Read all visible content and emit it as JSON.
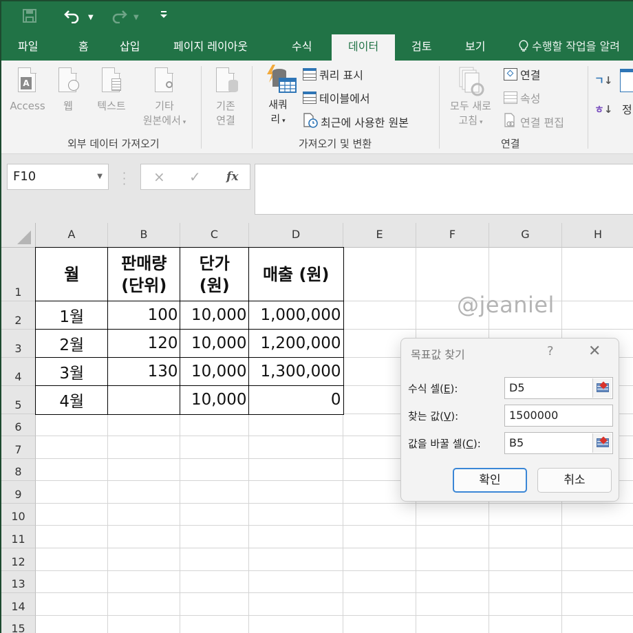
{
  "qat": {
    "save_icon": "save-icon",
    "undo_icon": "undo-icon",
    "redo_icon": "redo-icon",
    "customize_icon": "customize-qat-icon"
  },
  "tabs": [
    {
      "label": "파일"
    },
    {
      "label": "홈"
    },
    {
      "label": "삽입"
    },
    {
      "label": "페이지 레이아웃"
    },
    {
      "label": "수식"
    },
    {
      "label": "데이터",
      "active": true
    },
    {
      "label": "검토"
    },
    {
      "label": "보기"
    }
  ],
  "tell_me": "수행할 작업을 알려",
  "ribbon": {
    "get_external": {
      "label": "외부 데이터 가져오기",
      "access": "Access",
      "web": "웹",
      "text": "텍스트",
      "other_line1": "기타",
      "other_line2": "원본에서",
      "existing_line1": "기존",
      "existing_line2": "연결"
    },
    "get_transform": {
      "label": "가져오기 및 변환",
      "new_query_line1": "새쿼",
      "new_query_line2": "리",
      "show_queries": "쿼리 표시",
      "from_table": "테이블에서",
      "recent_sources": "최근에 사용한 원본"
    },
    "connections": {
      "label": "연결",
      "refresh_all_line1": "모두 새로",
      "refresh_all_line2": "고침",
      "connections": "연결",
      "properties": "속성",
      "edit_links": "연결 편집"
    },
    "sort": {
      "sort_label_partial": "정"
    }
  },
  "formula_bar": {
    "name_box": "F10",
    "cancel_icon": "×",
    "enter_icon": "✓",
    "fx": "fx",
    "formula": ""
  },
  "columns": [
    "A",
    "B",
    "C",
    "D",
    "E",
    "F",
    "G",
    "H"
  ],
  "rows": [
    "1",
    "2",
    "3",
    "4",
    "5",
    "6",
    "7",
    "8",
    "9",
    "10",
    "11",
    "12",
    "13",
    "14",
    "15"
  ],
  "table": {
    "headers": [
      {
        "line1": "월",
        "line2": ""
      },
      {
        "line1": "판매량",
        "line2": "(단위)"
      },
      {
        "line1": "단가",
        "line2": "(원)"
      },
      {
        "line1": "매출 (원)",
        "line2": ""
      }
    ],
    "rows": [
      [
        "1월",
        "100",
        "10,000",
        "1,000,000"
      ],
      [
        "2월",
        "120",
        "10,000",
        "1,200,000"
      ],
      [
        "3월",
        "130",
        "10,000",
        "1,300,000"
      ],
      [
        "4월",
        "",
        "10,000",
        "0"
      ]
    ]
  },
  "watermark": "@jeaniel",
  "dialog": {
    "title": "목표값 찾기",
    "help": "?",
    "close": "✕",
    "set_cell_label": "수식 셀(",
    "set_cell_key": "E",
    "set_cell_end": "):",
    "set_cell_value": "D5",
    "to_value_label": "찾는 값(",
    "to_value_key": "V",
    "to_value_end": "):",
    "to_value_value": "1500000",
    "changing_label": "값을 바꿀 셀(",
    "changing_key": "C",
    "changing_end": "):",
    "changing_value": "B5",
    "ok": "확인",
    "cancel": "취소"
  }
}
